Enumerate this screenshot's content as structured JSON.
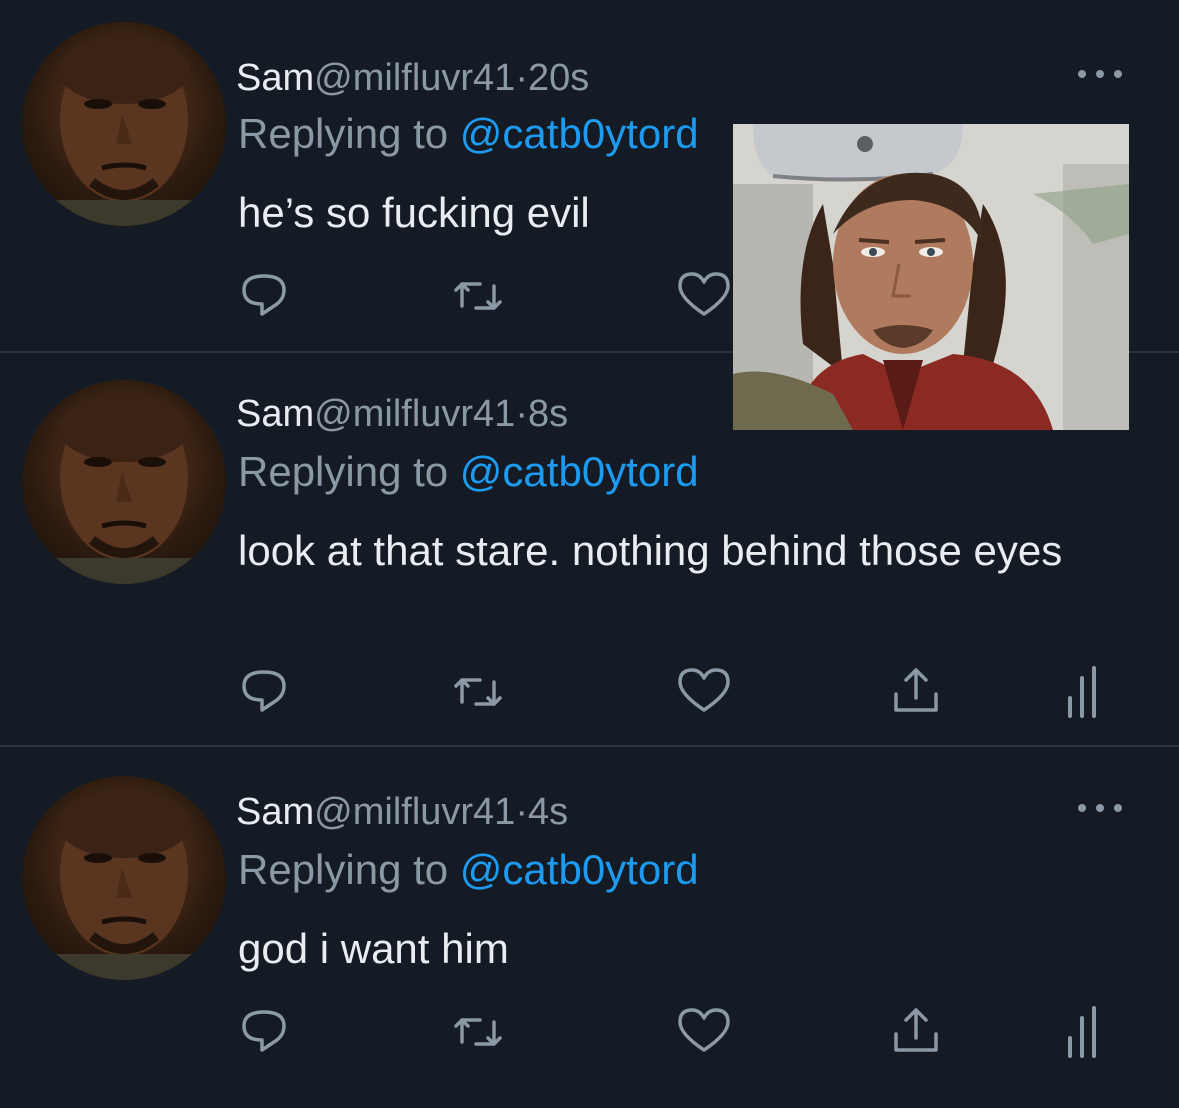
{
  "tweets": [
    {
      "name": "Sam",
      "handle": "@milfluvr41",
      "dot": "·",
      "time": "20s",
      "replying_prefix": "Replying to ",
      "replying_to": "@catb0ytord",
      "text": "he’s so fucking evil"
    },
    {
      "name": "Sam",
      "handle": "@milfluvr41",
      "dot": "·",
      "time": "8s",
      "replying_prefix": "Replying to ",
      "replying_to": "@catb0ytord",
      "text": "look at that stare. nothing behind those eyes"
    },
    {
      "name": "Sam",
      "handle": "@milfluvr41",
      "dot": "·",
      "time": "4s",
      "replying_prefix": "Replying to ",
      "replying_to": "@catb0ytord",
      "text": "god i want him"
    }
  ],
  "icons": {
    "reply": "reply-icon",
    "retweet": "retweet-icon",
    "like": "heart-icon",
    "share": "share-icon",
    "analytics": "analytics-icon",
    "more": "more-icon"
  },
  "colors": {
    "background": "#141b25",
    "text": "#e9edf1",
    "muted": "#8b98a5",
    "mention": "#1d9bf0",
    "divider": "#2a3340"
  }
}
